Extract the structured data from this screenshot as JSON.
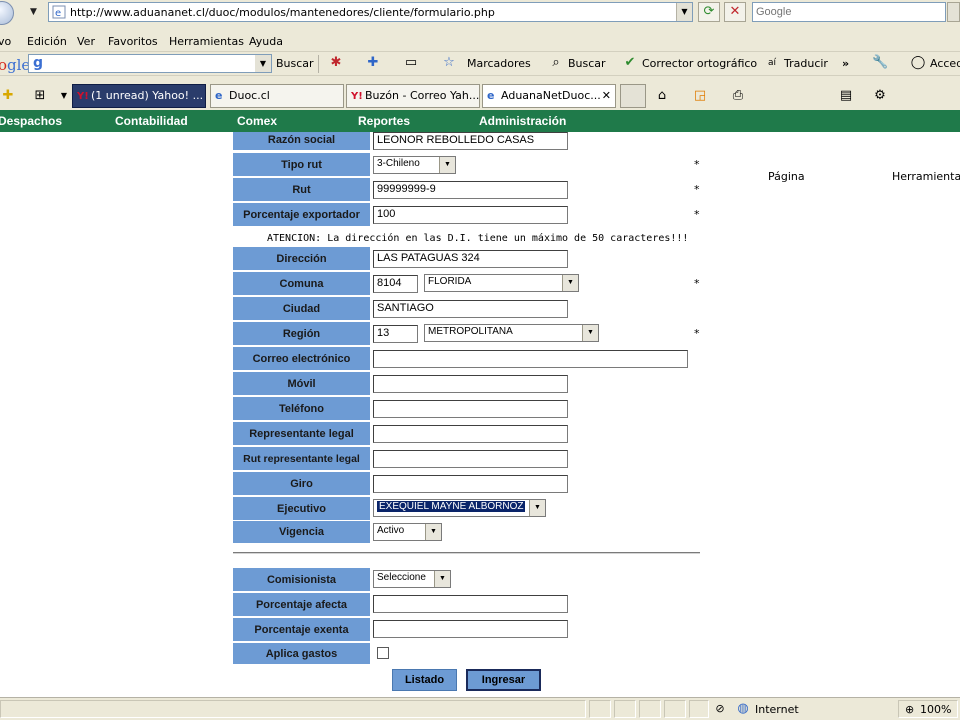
{
  "browser": {
    "url": "http://www.aduananet.cl/duoc/modulos/mantenedores/cliente/formulario.php",
    "search_placeholder": "Google",
    "menu": [
      "vo",
      "Edición",
      "Ver",
      "Favoritos",
      "Herramientas",
      "Ayuda"
    ],
    "google_bar": {
      "logo_a": "o",
      "logo_b": "gle",
      "search_label": "Buscar",
      "marcadores": "Marcadores",
      "buscar2": "Buscar",
      "corrector": "Corrector ortográfico",
      "traducir": "Traducir",
      "acced": "Acced"
    },
    "tabs": [
      {
        "label": "(1 unread) Yahoo! ..."
      },
      {
        "label": "Duoc.cl"
      },
      {
        "label": "Buzón - Correo Yah..."
      },
      {
        "label": "AduanaNetDuoc..."
      }
    ],
    "cmd": {
      "pagina": "Página",
      "herramientas": "Herramientas"
    }
  },
  "app_nav": [
    "Despachos",
    "Contabilidad",
    "Comex",
    "Reportes",
    "Administración"
  ],
  "form": {
    "razon_social": {
      "label": "Razón social",
      "value": "LEONOR  REBOLLEDO CASAS"
    },
    "tipo_rut": {
      "label": "Tipo rut",
      "value": "3-Chileno"
    },
    "rut": {
      "label": "Rut",
      "value": "99999999-9"
    },
    "porcentaje_exportador": {
      "label": "Porcentaje exportador",
      "value": "100"
    },
    "notice": "ATENCION: La dirección en las D.I. tiene un máximo de 50 caracteres!!!",
    "direccion": {
      "label": "Dirección",
      "value": "LAS PATAGUAS 324"
    },
    "comuna": {
      "label": "Comuna",
      "code": "8104",
      "value": "FLORIDA"
    },
    "ciudad": {
      "label": "Ciudad",
      "value": "SANTIAGO"
    },
    "region": {
      "label": "Región",
      "code": "13",
      "value": "METROPOLITANA"
    },
    "correo": {
      "label": "Correo electrónico",
      "value": ""
    },
    "movil": {
      "label": "Móvil",
      "value": ""
    },
    "telefono": {
      "label": "Teléfono",
      "value": ""
    },
    "representante": {
      "label": "Representante legal",
      "value": ""
    },
    "rut_representante": {
      "label": "Rut representante legal",
      "value": ""
    },
    "giro": {
      "label": "Giro",
      "value": ""
    },
    "ejecutivo": {
      "label": "Ejecutivo",
      "value": "EXEQUIEL MAYNE ALBORNOZ"
    },
    "vigencia": {
      "label": "Vigencia",
      "value": "Activo"
    },
    "comisionista": {
      "label": "Comisionista",
      "value": "Seleccione"
    },
    "porcentaje_afecta": {
      "label": "Porcentaje afecta",
      "value": ""
    },
    "porcentaje_exenta": {
      "label": "Porcentaje exenta",
      "value": ""
    },
    "aplica_gastos": {
      "label": "Aplica gastos",
      "checked": false
    },
    "required_mark": "*",
    "buttons": {
      "listado": "Listado",
      "ingresar": "Ingresar"
    }
  },
  "status": {
    "zone": "Internet",
    "zoom": "100%"
  }
}
